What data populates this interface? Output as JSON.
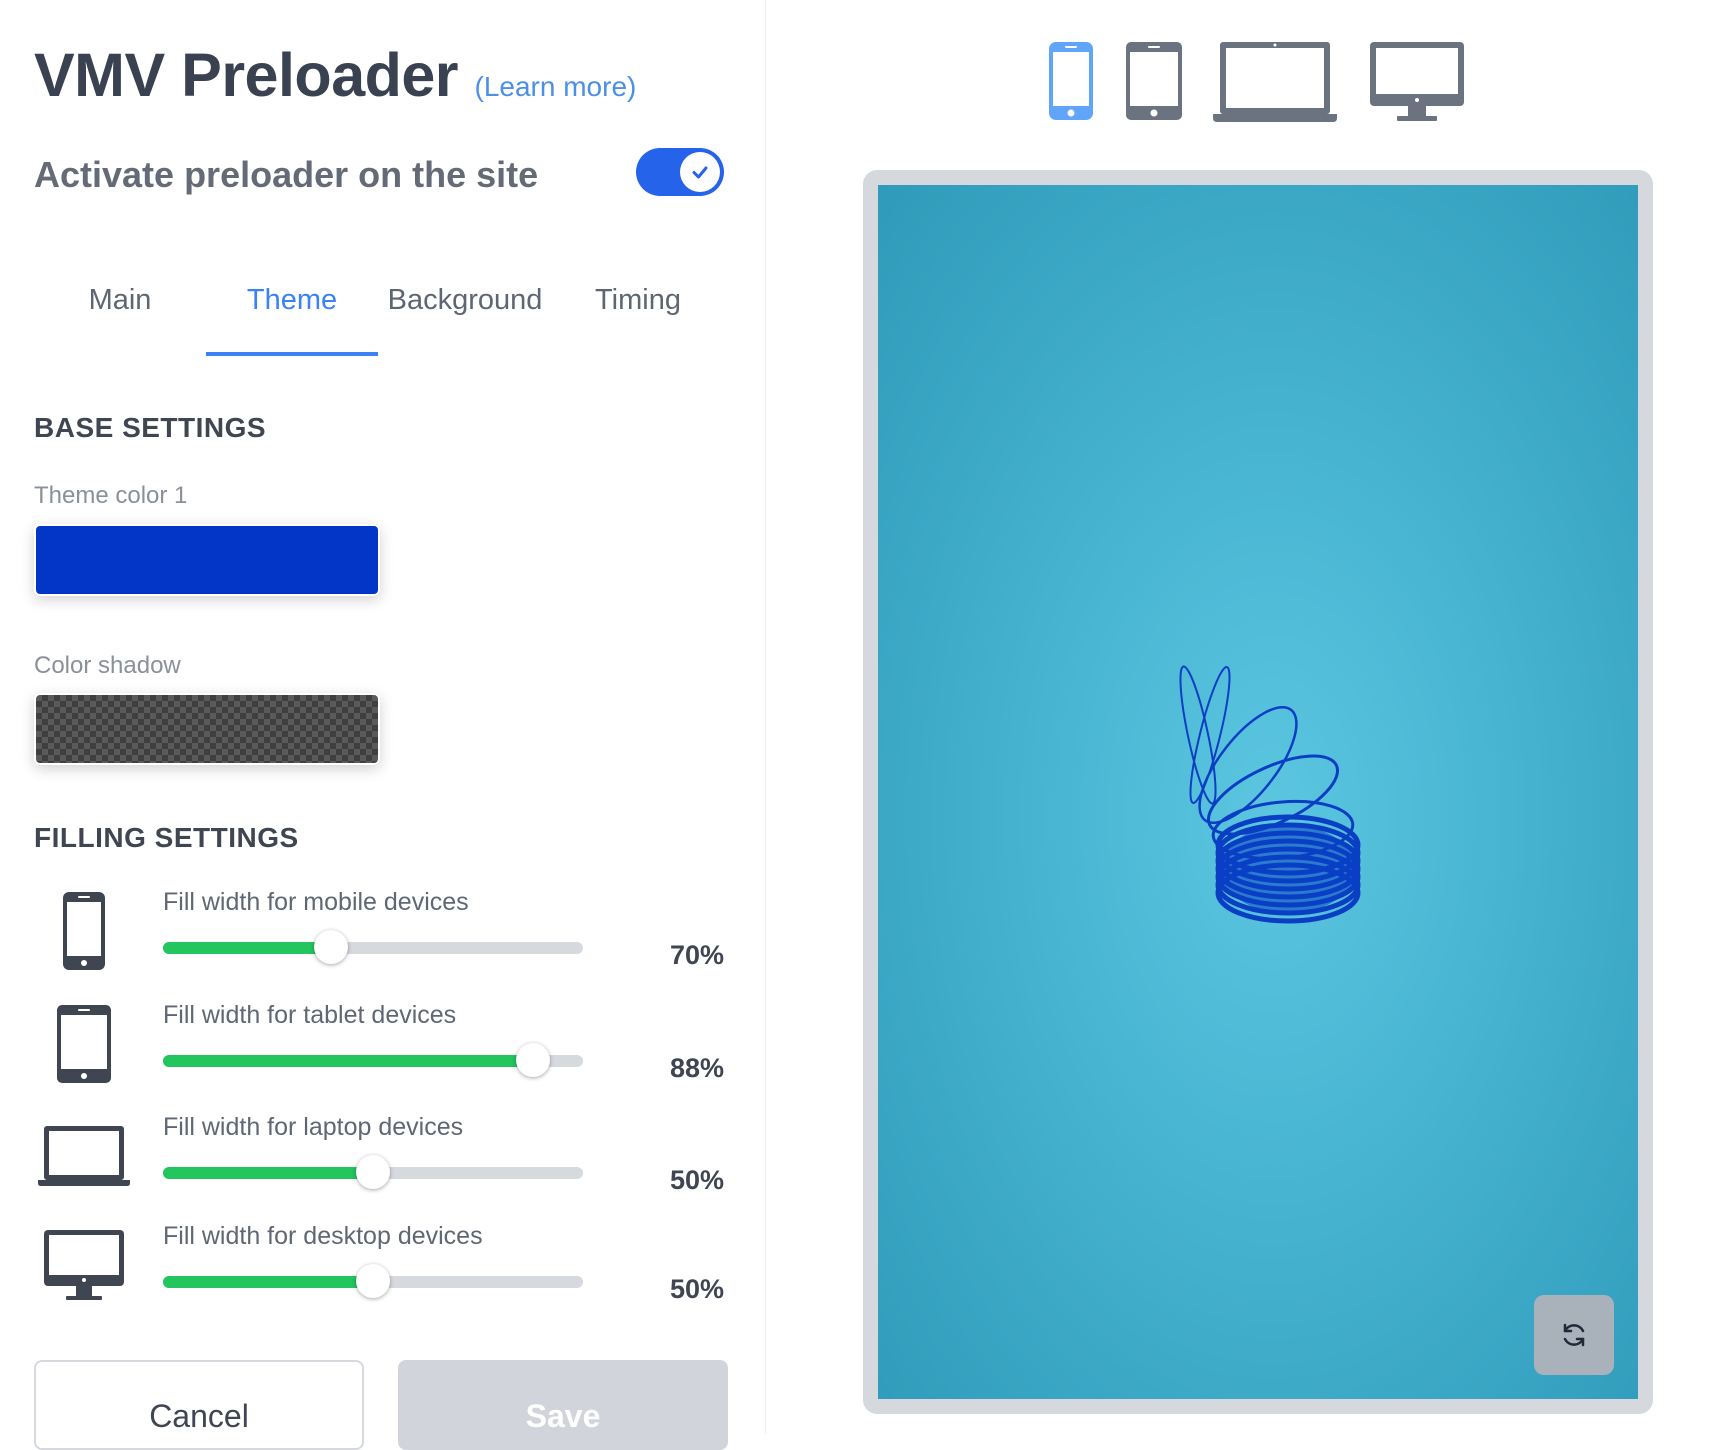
{
  "header": {
    "title": "VMV Preloader",
    "learn_more": "(Learn more)"
  },
  "activate": {
    "label": "Activate preloader on the site",
    "enabled": true
  },
  "tabs": [
    {
      "label": "Main",
      "active": false
    },
    {
      "label": "Theme",
      "active": true
    },
    {
      "label": "Background",
      "active": false
    },
    {
      "label": "Timing",
      "active": false
    }
  ],
  "base_settings": {
    "heading": "BASE SETTINGS",
    "theme_color_label": "Theme color 1",
    "theme_color": "#0336c6",
    "color_shadow_label": "Color shadow",
    "color_shadow": "transparent"
  },
  "filling_settings": {
    "heading": "FILLING SETTINGS",
    "rows": [
      {
        "icon": "phone-icon",
        "label": "Fill width for mobile devices",
        "value_text": "70%",
        "slider_fraction": 0.4
      },
      {
        "icon": "tablet-icon",
        "label": "Fill width for tablet devices",
        "value_text": "88%",
        "slider_fraction": 0.88
      },
      {
        "icon": "laptop-icon",
        "label": "Fill width for laptop devices",
        "value_text": "50%",
        "slider_fraction": 0.5
      },
      {
        "icon": "desktop-icon",
        "label": "Fill width for desktop devices",
        "value_text": "50%",
        "slider_fraction": 0.5
      }
    ]
  },
  "buttons": {
    "cancel": "Cancel",
    "save": "Save"
  },
  "preview": {
    "devices": [
      "phone-icon",
      "tablet-icon",
      "laptop-icon",
      "desktop-icon"
    ],
    "selected_device": "phone-icon",
    "background_color": "#4bb9d6",
    "refresh_icon": "refresh-icon"
  },
  "colors": {
    "accent": "#3b82f6",
    "toggle": "#2563eb",
    "slider_fill": "#22c55e",
    "icon_default": "#6b7280"
  }
}
